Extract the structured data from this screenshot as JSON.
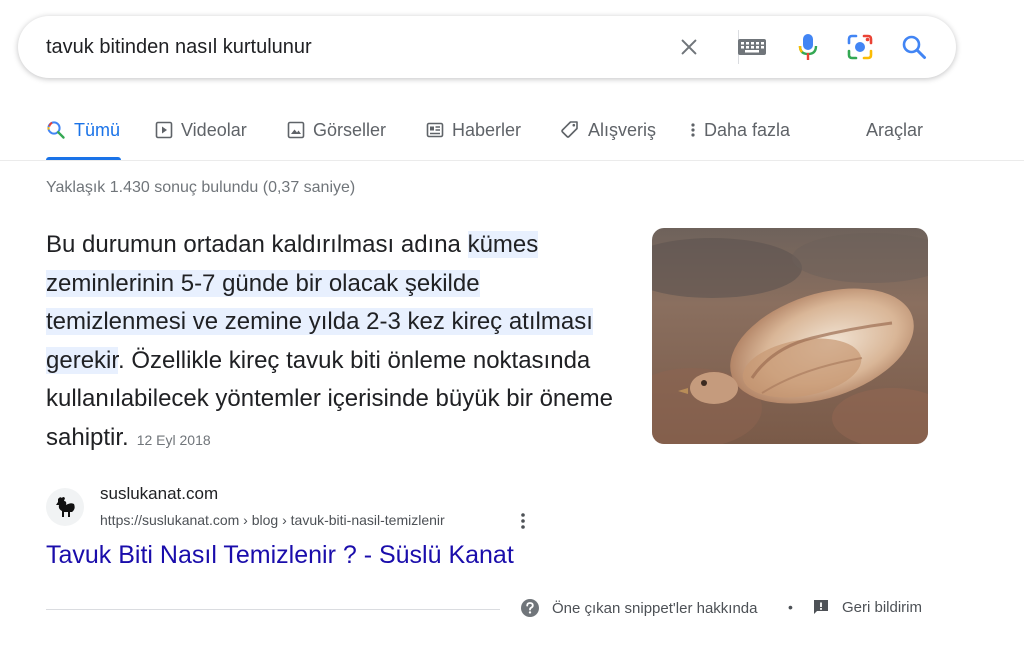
{
  "search": {
    "query": "tavuk bitinden nasıl kurtulunur"
  },
  "tabs": [
    {
      "label": "Tümü",
      "icon": "search-icon",
      "active": true
    },
    {
      "label": "Videolar",
      "icon": "video-icon"
    },
    {
      "label": "Görseller",
      "icon": "image-icon"
    },
    {
      "label": "Haberler",
      "icon": "news-icon"
    },
    {
      "label": "Alışveriş",
      "icon": "tag-icon"
    },
    {
      "label": "Daha fazla",
      "icon": "more-vert-icon"
    }
  ],
  "tools_label": "Araçlar",
  "result_stats": "Yaklaşık 1.430 sonuç bulundu (0,37 saniye)",
  "snippet": {
    "text_before": "Bu durumun ortadan kaldırılması adına ",
    "highlight": "kümes zeminlerinin 5-7 günde bir olacak şekilde temizlenmesi ve zemine yılda 2-3 kez kireç atılması gerekir",
    "text_after": ". Özellikle kireç tavuk biti önleme noktasında kullanılabilecek yöntemler içerisinde büyük bir öneme sahiptir.",
    "date": "12 Eyl 2018",
    "image_alt": "chicken-photo"
  },
  "source": {
    "site_name": "suslukanat.com",
    "url": "https://suslukanat.com › blog › tavuk-biti-nasil-temizlenir",
    "title": "Tavuk Biti Nasıl Temizlenir ? - Süslü Kanat"
  },
  "footer": {
    "about": "Öne çıkan snippet'ler hakkında",
    "separator": "•",
    "feedback": "Geri bildirim"
  },
  "colors": {
    "accent": "#1a73e8",
    "link": "#1a0dab",
    "highlight": "#e8f0fe"
  }
}
